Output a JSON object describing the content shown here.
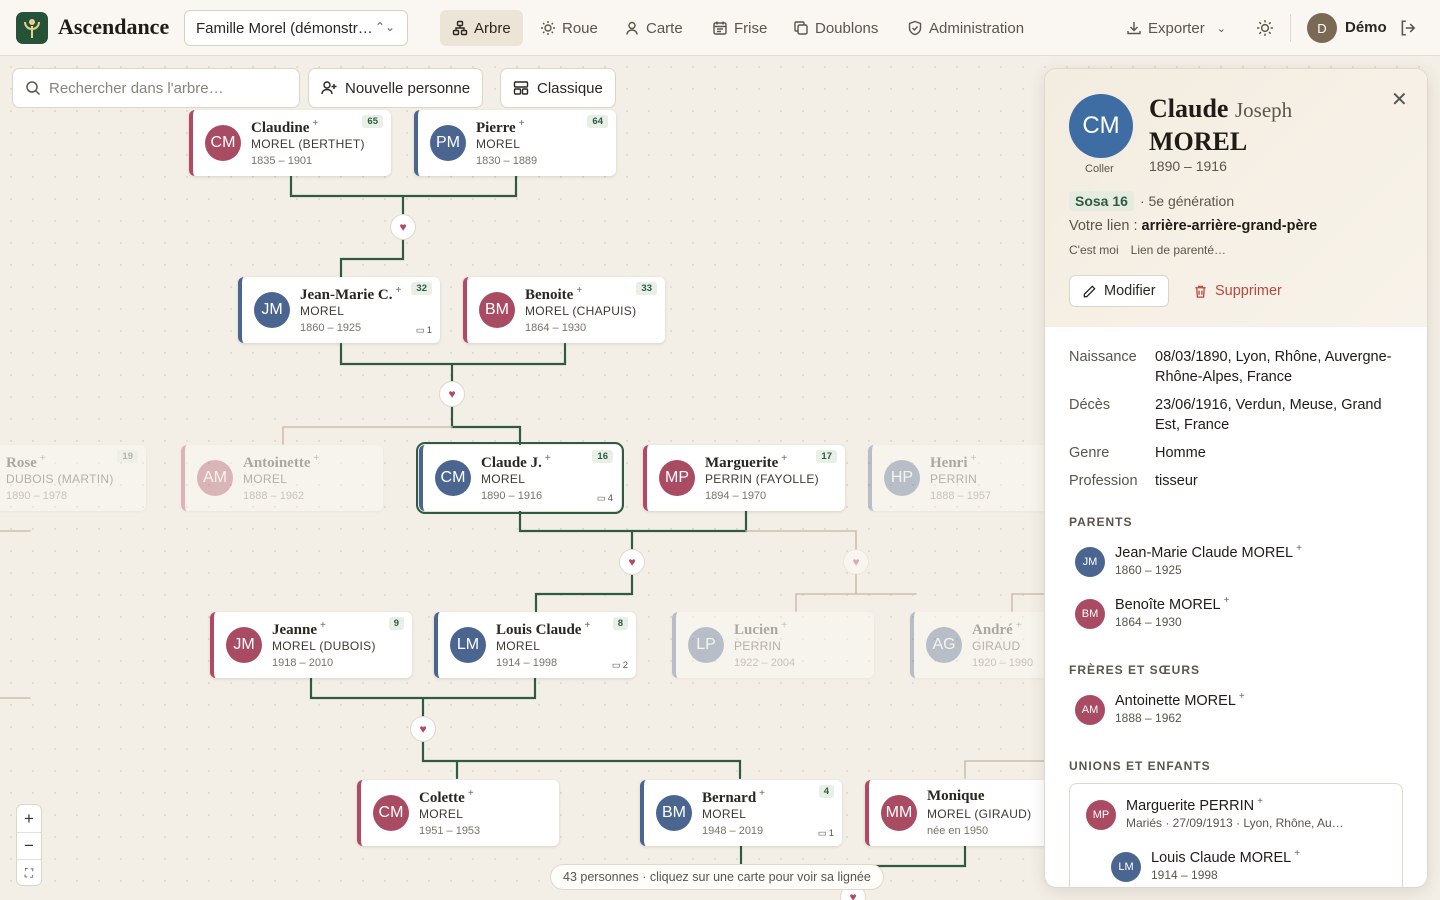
{
  "app": {
    "brand": "Ascendance",
    "tree_name": "Famille Morel (démonstr…"
  },
  "nav": [
    {
      "label": "Arbre",
      "icon": "tree-icon",
      "active": true
    },
    {
      "label": "Roue",
      "icon": "sun-icon",
      "active": false
    },
    {
      "label": "Carte",
      "icon": "map-pin-icon",
      "active": false
    },
    {
      "label": "Frise",
      "icon": "calendar-icon",
      "active": false
    },
    {
      "label": "Doublons",
      "icon": "copy-icon",
      "active": false
    },
    {
      "label": "Administration",
      "icon": "shield-icon",
      "active": false
    }
  ],
  "header": {
    "export_label": "Exporter",
    "user_initial": "D",
    "user_name": "Démo"
  },
  "toolbar": {
    "search_placeholder": "Rechercher dans l'arbre…",
    "new_person": "Nouvelle personne",
    "layout": "Classique"
  },
  "cards": {
    "claudine": {
      "av": "CM",
      "first": "Claudine",
      "last": "MOREL (BERTHET)",
      "dates": "1835 – 1901",
      "sosa": "65"
    },
    "pierre": {
      "av": "PM",
      "first": "Pierre",
      "last": "MOREL",
      "dates": "1830 – 1889",
      "sosa": "64"
    },
    "jeanmarie": {
      "av": "JM",
      "first": "Jean-Marie C.",
      "last": "MOREL",
      "dates": "1860 – 1925",
      "sosa": "32",
      "unions": "1"
    },
    "benoite": {
      "av": "BM",
      "first": "Benoite",
      "last": "MOREL (CHAPUIS)",
      "dates": "1864 – 1930",
      "sosa": "33"
    },
    "rose": {
      "first": "Rose",
      "last": "DUBOIS (MARTIN)",
      "dates": "1890 – 1978",
      "sosa": "19"
    },
    "antoinette": {
      "av": "AM",
      "first": "Antoinette",
      "last": "MOREL",
      "dates": "1888 – 1962"
    },
    "claude": {
      "av": "CM",
      "first": "Claude J.",
      "last": "MOREL",
      "dates": "1890 – 1916",
      "sosa": "16",
      "unions": "4"
    },
    "marguerite": {
      "av": "MP",
      "first": "Marguerite",
      "last": "PERRIN (FAYOLLE)",
      "dates": "1894 – 1970",
      "sosa": "17"
    },
    "henri": {
      "av": "HP",
      "first": "Henri",
      "last": "PERRIN",
      "dates": "1888 – 1957"
    },
    "jeanne": {
      "av": "JM",
      "first": "Jeanne",
      "last": "MOREL (DUBOIS)",
      "dates": "1918 – 2010",
      "sosa": "9"
    },
    "louis": {
      "av": "LM",
      "first": "Louis Claude",
      "last": "MOREL",
      "dates": "1914 – 1998",
      "sosa": "8",
      "unions": "2"
    },
    "lucien": {
      "av": "LP",
      "first": "Lucien",
      "last": "PERRIN",
      "dates": "1922 – 2004"
    },
    "andre": {
      "av": "AG",
      "first": "André",
      "last": "GIRAUD",
      "dates": "1920 – 1990"
    },
    "colette": {
      "av": "CM",
      "first": "Colette",
      "last": "MOREL",
      "dates": "1951 – 1953"
    },
    "bernard": {
      "av": "BM",
      "first": "Bernard",
      "last": "MOREL",
      "dates": "1948 – 2019",
      "sosa": "4",
      "unions": "1"
    },
    "monique": {
      "av": "MM",
      "first": "Monique",
      "last": "MOREL (GIRAUD)",
      "dates": "née en 1950"
    }
  },
  "status": "43 personnes · cliquez sur une carte pour voir sa lignée",
  "panel": {
    "avatar": "CM",
    "coller": "Coller",
    "first": "Claude",
    "middle": "Joseph",
    "last": "MOREL",
    "dates": "1890 – 1916",
    "sosa": "Sosa 16",
    "generation": "· 5e génération",
    "lien_label": "Votre lien :",
    "lien_value": "arrière-arrière-grand-père",
    "cest_moi": "C'est moi",
    "lien_parente": "Lien de parenté…",
    "modifier": "Modifier",
    "supprimer": "Supprimer",
    "facts": [
      {
        "k": "Naissance",
        "v": "08/03/1890, Lyon, Rhône, Auvergne-Rhône-Alpes, France"
      },
      {
        "k": "Décès",
        "v": "23/06/1916, Verdun, Meuse, Grand Est, France"
      },
      {
        "k": "Genre",
        "v": "Homme"
      },
      {
        "k": "Profession",
        "v": "tisseur"
      }
    ],
    "sec_parents": "PARENTS",
    "parents": [
      {
        "av": "JM",
        "name": "Jean-Marie Claude MOREL",
        "dates": "1860 – 1925"
      },
      {
        "av": "BM",
        "name": "Benoîte MOREL",
        "dates": "1864 – 1930"
      }
    ],
    "sec_siblings": "FRÈRES ET SŒURS",
    "siblings": [
      {
        "av": "AM",
        "name": "Antoinette MOREL",
        "dates": "1888 – 1962"
      }
    ],
    "sec_unions": "UNIONS ET ENFANTS",
    "union": {
      "av": "MP",
      "name": "Marguerite PERRIN",
      "detail": "Mariés · 27/09/1913 · Lyon, Rhône, Au…"
    },
    "child": {
      "av": "LM",
      "name": "Louis Claude MOREL",
      "dates": "1914 – 1998"
    }
  },
  "colors": {
    "accent": "#2f5a44",
    "male": "#4a6690",
    "female": "#b04a62",
    "danger": "#b8483d"
  }
}
